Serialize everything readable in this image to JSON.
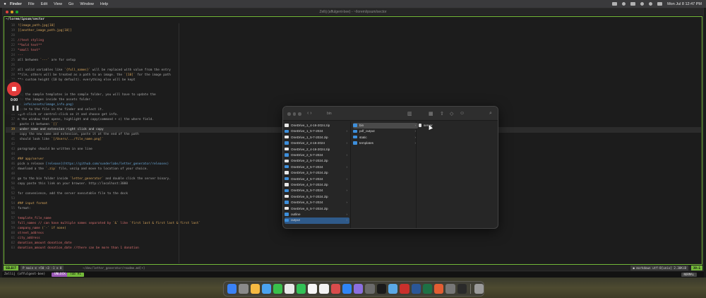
{
  "menubar": {
    "app": "Finder",
    "items": [
      "File",
      "Edit",
      "View",
      "Go",
      "Window",
      "Help"
    ],
    "clock": "Mon Jul 8  12:47 PM"
  },
  "terminal": {
    "window_title": "Zellij (affulgent-bee) - ~/lorem/ipsum/sector",
    "pane_title": "~/lorem/ipsum/sector",
    "lines": [
      {
        "n": "18",
        "segs": [
          {
            "c": "t-str",
            "t": "![image_path.jpg|10]"
          }
        ]
      },
      {
        "n": "19",
        "segs": [
          {
            "c": "t-str",
            "t": "[[another_image_path.jpg|10]]"
          }
        ]
      },
      {
        "n": "20",
        "segs": []
      },
      {
        "n": "21",
        "segs": [
          {
            "c": "t-pink",
            "t": "//text styling"
          }
        ]
      },
      {
        "n": "22",
        "segs": [
          {
            "c": "t-pink",
            "t": "**bold text**"
          }
        ]
      },
      {
        "n": "23",
        "segs": [
          {
            "c": "t-pink",
            "t": "*small text*"
          }
        ]
      },
      {
        "n": "24",
        "segs": [
          {
            "c": "t-pink",
            "t": "---"
          }
        ]
      },
      {
        "n": "25",
        "segs": [
          {
            "c": "t-dim",
            "t": "all between "
          },
          {
            "c": "t-str",
            "t": "`---`"
          },
          {
            "c": "t-dim",
            "t": " are for setup"
          }
        ]
      },
      {
        "n": "26",
        "segs": []
      },
      {
        "n": "27",
        "segs": [
          {
            "c": "t-dim",
            "t": "all valid variables like "
          },
          {
            "c": "t-str",
            "t": "`{full_names}`"
          },
          {
            "c": "t-dim",
            "t": " will be replaced with value from the entry"
          }
        ]
      },
      {
        "n": "28",
        "segs": [
          {
            "c": "t-dim",
            "t": "**ile, others will be treated as a path to an image. the "
          },
          {
            "c": "t-str",
            "t": "`[10]`"
          },
          {
            "c": "t-dim",
            "t": " for the image path"
          }
        ]
      },
      {
        "n": "29",
        "segs": [
          {
            "c": "t-dim",
            "t": "**e custom height (10 by default). everything else will be kept"
          }
        ]
      },
      {
        "n": "30",
        "segs": []
      },
      {
        "n": "31",
        "segs": []
      },
      {
        "n": "32",
        "segs": [
          {
            "c": "t-dim",
            "t": "ing the sample templates in the sample folder, you will have to update the"
          }
        ]
      },
      {
        "n": "33",
        "segs": [
          {
            "c": "t-dim",
            "t": " to the images inside the assets folder."
          }
        ]
      },
      {
        "n": "34",
        "segs": [
          {
            "c": "t-link",
            "t": "ue_info(assets/image_info.png)"
          }
        ]
      },
      {
        "n": "35",
        "segs": [
          {
            "c": "t-dim",
            "t": "igate to the file in the finder and select it."
          }
        ]
      },
      {
        "n": "36",
        "segs": [
          {
            "c": "t-dim",
            "t": "ight-click or control-click on it and choose get info."
          }
        ]
      },
      {
        "n": "37",
        "segs": [
          {
            "c": "t-dim",
            "t": "n the window that opens, highlight and copy(command + c) the where field."
          }
        ]
      },
      {
        "n": "38",
        "segs": [
          {
            "c": "t-dim",
            "t": " paste it between "
          },
          {
            "c": "t-str",
            "t": "`[]`"
          }
        ]
      },
      {
        "n": "39",
        "segs": [
          {
            "c": "t-hl",
            "t": " under name and extension right click and copy"
          }
        ],
        "cur": true
      },
      {
        "n": "40",
        "segs": [
          {
            "c": "t-dim",
            "t": " copy the new name and extension, paste it at the end of the path"
          }
        ]
      },
      {
        "n": "41",
        "segs": [
          {
            "c": "t-dim",
            "t": " should look like "
          },
          {
            "c": "t-str",
            "t": "`[/Users/.../file_name.png]`"
          }
        ]
      },
      {
        "n": "42",
        "segs": []
      },
      {
        "n": "43",
        "segs": [
          {
            "c": "t-dim",
            "t": "paragraphs should be written in one line"
          }
        ]
      },
      {
        "n": "44",
        "segs": []
      },
      {
        "n": "45",
        "segs": [
          {
            "c": "t-str",
            "t": "### app/server"
          }
        ]
      },
      {
        "n": "46",
        "segs": [
          {
            "c": "t-dim",
            "t": "pick a release "
          },
          {
            "c": "t-link",
            "t": "[release](https://github.com/sunderlabs/letter_generator/releases)"
          }
        ]
      },
      {
        "n": "47",
        "segs": [
          {
            "c": "t-dim",
            "t": "download a the "
          },
          {
            "c": "t-str",
            "t": "`.zip`"
          },
          {
            "c": "t-dim",
            "t": " file, unzip and move to location of your choice."
          }
        ]
      },
      {
        "n": "48",
        "segs": []
      },
      {
        "n": "49",
        "segs": [
          {
            "c": "t-dim",
            "t": "go to the bin folder inside "
          },
          {
            "c": "t-str",
            "t": "`letter_generator`"
          },
          {
            "c": "t-dim",
            "t": " and double click the server binary."
          }
        ]
      },
      {
        "n": "50",
        "segs": [
          {
            "c": "t-dim",
            "t": "copy paste this link on your browser. http://localhost:3000"
          }
        ]
      },
      {
        "n": "51",
        "segs": []
      },
      {
        "n": "52",
        "segs": [
          {
            "c": "t-dim",
            "t": "for convenience, add the server executable file to the dock"
          }
        ]
      },
      {
        "n": "53",
        "segs": []
      },
      {
        "n": "54",
        "segs": [
          {
            "c": "t-str",
            "t": "### input format"
          }
        ]
      },
      {
        "n": "55",
        "segs": [
          {
            "c": "t-dim",
            "t": "format:"
          }
        ]
      },
      {
        "n": "56",
        "segs": []
      },
      {
        "n": "57",
        "segs": [
          {
            "c": "t-pink",
            "t": "template_file_name"
          }
        ]
      },
      {
        "n": "58",
        "segs": [
          {
            "c": "t-pink",
            "t": "full_names // can have multiple names separated by "
          },
          {
            "c": "t-str",
            "t": "`&`"
          },
          {
            "c": "t-pink",
            "t": " like "
          },
          {
            "c": "t-str",
            "t": "`first last & first last & first last`"
          }
        ]
      },
      {
        "n": "59",
        "segs": [
          {
            "c": "t-pink",
            "t": "company_name "
          },
          {
            "c": "t-str",
            "t": "(`-` if none)"
          }
        ]
      },
      {
        "n": "60",
        "segs": [
          {
            "c": "t-pink",
            "t": "street_address"
          }
        ]
      },
      {
        "n": "61",
        "segs": [
          {
            "c": "t-pink",
            "t": "city_address"
          }
        ]
      },
      {
        "n": "62",
        "segs": [
          {
            "c": "t-pink",
            "t": "donation_amount donation_date"
          }
        ]
      },
      {
        "n": "63",
        "segs": [
          {
            "c": "t-pink",
            "t": "donation_amount donation_date //there can be more than 1 donation"
          }
        ]
      }
    ],
    "status": {
      "mode": "SELECT",
      "branch": "P main ⑆ +50 ~3 -1 ⊙ 0",
      "path": "~/dev/letter_generator/readme.md[+]",
      "filetype": "● markdown  utf-8[unix]  2.30KiB",
      "position": "39:1"
    },
    "zellij": {
      "session": "Zellij (affulgent-bee)",
      "tab_a": "UNLOCK",
      "tab_b": "Tab #1",
      "hint": "NORMAL"
    }
  },
  "recording": {
    "time": "0:00"
  },
  "finder": {
    "nav_title": "bin",
    "col1": [
      "OneDrive_1_4-16-2024.zip",
      "OneDrive_1_5-7-2024",
      "OneDrive_1_5-7-2024.zip",
      "OneDrive_2_4-16-2024",
      "OneDrive_2_4-16-2024.zip",
      "OneDrive_2_5-7-2024",
      "OneDrive_2_5-7-2024.zip",
      "OneDrive_3_5-7-2024",
      "OneDrive_3_5-7-2024.zip",
      "OneDrive_4_5-7-2024",
      "OneDrive_4_5-7-2024.zip",
      "OneDrive_5_5-7-2024",
      "OneDrive_5_5-7-2024.zip",
      "OneDrive_6_5-7-2024",
      "OneDrive_6_5-7-2024.zip",
      "outline",
      "output"
    ],
    "col2": [
      "bin",
      "pdf_output",
      "static",
      "templates"
    ],
    "col3": [
      "server"
    ]
  },
  "colors": {
    "pane_border": "#74b93a",
    "record_red": "#e23b3b",
    "folder_blue": "#3d8fdc"
  }
}
